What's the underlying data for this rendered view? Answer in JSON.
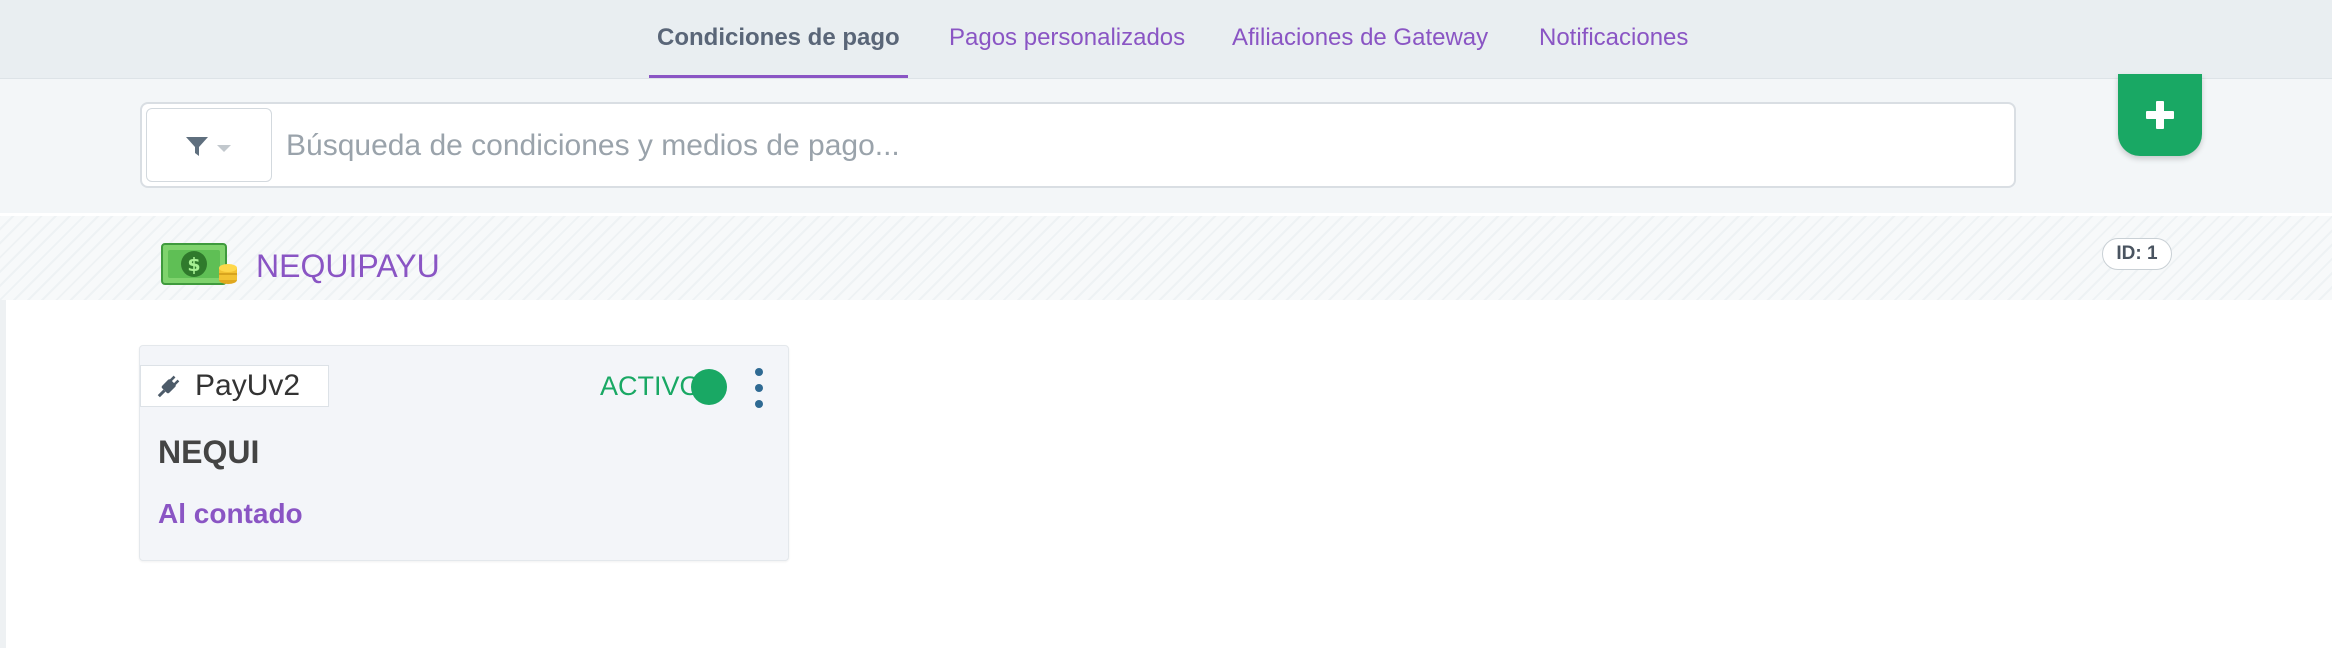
{
  "tabs": [
    {
      "label": "Condiciones de pago",
      "active": true
    },
    {
      "label": "Pagos personalizados",
      "active": false
    },
    {
      "label": "Afiliaciones de Gateway",
      "active": false
    },
    {
      "label": "Notificaciones",
      "active": false
    }
  ],
  "search": {
    "placeholder": "Búsqueda de condiciones y medios de pago...",
    "value": "",
    "filter_icon": "filter-icon",
    "dropdown_icon": "caret-down-icon"
  },
  "add_button": {
    "icon": "plus-icon"
  },
  "group": {
    "icon": "money-icon",
    "title": "NEQUIPAYU",
    "id_badge": "ID: 1"
  },
  "card": {
    "gateway": {
      "icon": "plug-icon",
      "label": "PayUv2"
    },
    "status": {
      "label": "ACTIVO",
      "color": "#19a864"
    },
    "menu_icon": "kebab-menu-icon",
    "method_name": "NEQUI",
    "terms": "Al contado"
  },
  "colors": {
    "accent": "#8a55c4",
    "success": "#19a864",
    "tab_bar": "#e9eef1",
    "search_area": "#f3f6f8",
    "menu_dots": "#2f6a93"
  }
}
